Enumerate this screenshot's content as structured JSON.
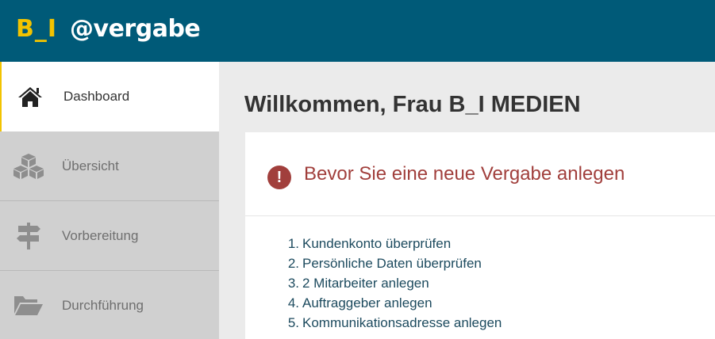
{
  "header": {
    "logo_prefix": "B_I",
    "logo_suffix": "@vergabe"
  },
  "sidebar": {
    "items": [
      {
        "label": "Dashboard",
        "icon": "home-icon",
        "active": true
      },
      {
        "label": "Übersicht",
        "icon": "cubes-icon",
        "active": false
      },
      {
        "label": "Vorbereitung",
        "icon": "signpost-icon",
        "active": false
      },
      {
        "label": "Durchführung",
        "icon": "folder-open-icon",
        "active": false
      }
    ]
  },
  "main": {
    "title": "Willkommen, Frau B_I MEDIEN",
    "notice": {
      "icon": "exclamation-icon",
      "icon_glyph": "!",
      "heading": "Bevor Sie eine neue Vergabe anlegen"
    },
    "steps": [
      {
        "num": "1.",
        "text": "Kundenkonto überprüfen"
      },
      {
        "num": "2.",
        "text": "Persönliche Daten überprüfen"
      },
      {
        "num": "3.",
        "text": "2 Mitarbeiter anlegen"
      },
      {
        "num": "4.",
        "text": "Auftraggeber anlegen"
      },
      {
        "num": "5.",
        "text": "Kommunikationsadresse anlegen"
      }
    ]
  },
  "colors": {
    "header_bg": "#005a78",
    "logo_accent": "#f2c300",
    "warning": "#a13f3c",
    "link": "#1c4a5e"
  }
}
